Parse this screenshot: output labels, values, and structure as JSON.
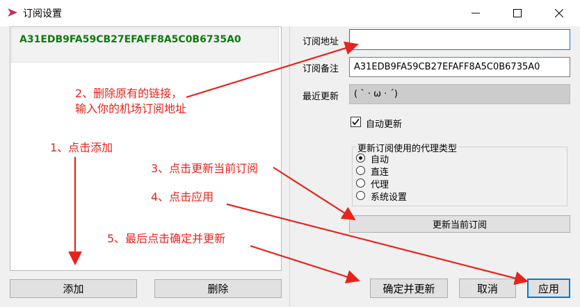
{
  "window": {
    "title": "订阅设置"
  },
  "subscriptions": {
    "items": [
      {
        "name": "A31EDB9FA59CB27EFAFF8A5C0B6735A0"
      }
    ]
  },
  "buttons": {
    "add": "添加",
    "delete": "删除",
    "update_current": "更新当前订阅",
    "ok_update": "确定并更新",
    "cancel": "取消",
    "apply": "应用"
  },
  "form": {
    "url_label": "订阅地址",
    "url_value": "",
    "remark_label": "订阅备注",
    "remark_value": "A31EDB9FA59CB27EFAFF8A5C0B6735A0",
    "last_update_label": "最近更新",
    "last_update_value": "( ` · ω · ´)",
    "auto_update_label": "自动更新",
    "auto_update_checked": true
  },
  "proxy": {
    "title": "更新订阅使用的代理类型",
    "options": [
      "自动",
      "直连",
      "代理",
      "系统设置"
    ],
    "selected": "自动"
  },
  "annotations": {
    "step1": "1、点击添加",
    "step2_line1": "2、删除原有的链接，",
    "step2_line2": "输入你的机场订阅地址",
    "step3": "3、点击更新当前订阅",
    "step4": "4、点击应用",
    "step5": "5、最后点击确定并更新"
  },
  "colors": {
    "annotation": "#e8231b",
    "item_text": "#0e7a0e",
    "focus": "#0078d7"
  }
}
